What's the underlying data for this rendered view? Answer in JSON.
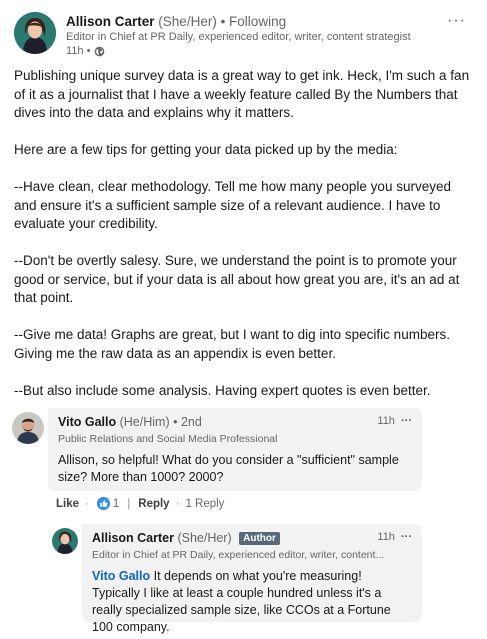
{
  "post": {
    "author_name": "Allison Carter",
    "author_pronouns": "(She/Her)",
    "follow_status": "• Following",
    "author_title": "Editor in Chief at PR Daily, experienced editor, writer, content strategist",
    "time": "11h •",
    "more_menu": "···",
    "paragraphs": [
      "Publishing unique survey data is a great way to get ink. Heck, I'm such a fan of it as a journalist that I have a weekly feature called By the Numbers that dives into the data and explains why it matters.",
      "Here are a few tips for getting your data picked up by the media:",
      "--Have clean, clear methodology. Tell me how many people you surveyed and ensure it's a sufficient sample size of a relevant audience. I have to evaluate your credibility.",
      "--Don't be overtly salesy. Sure, we understand the point is to promote your good or service, but if your data is all about how great you are, it's an ad at that point.",
      "--Give me data! Graphs are great, but I want to dig into specific numbers. Giving me the raw data as an appendix is even better.",
      "--But also include some analysis. Having expert quotes is even better."
    ]
  },
  "comment1": {
    "name": "Vito Gallo",
    "pronouns": "(He/Him)",
    "degree": "• 2nd",
    "title": "Public Relations and Social Media Professional",
    "time": "11h",
    "more_menu": "···",
    "text": "Allison, so helpful! What do you consider a \"sufficient\" sample size? More than 1000? 2000?",
    "actions": {
      "like": "Like",
      "like_count": "1",
      "reply": "Reply",
      "reply_count": "1 Reply",
      "sep1": "·",
      "sep2": "|",
      "sep3": "·"
    }
  },
  "reply1": {
    "name": "Allison Carter",
    "pronouns": "(She/Her)",
    "badge": "Author",
    "title": "Editor in Chief at PR Daily, experienced editor, writer, content...",
    "time": "11h",
    "more_menu": "···",
    "mention": "Vito Gallo",
    "text": " It depends on what you're measuring! Typically I like at least a couple hundred unless it's a really specialized sample size, like CCOs at a Fortune 100 company."
  },
  "colors": {
    "link": "#0a66c2",
    "badge": "#56687a",
    "bubble": "#f2f2f2",
    "like_reaction": "#378fe9"
  }
}
